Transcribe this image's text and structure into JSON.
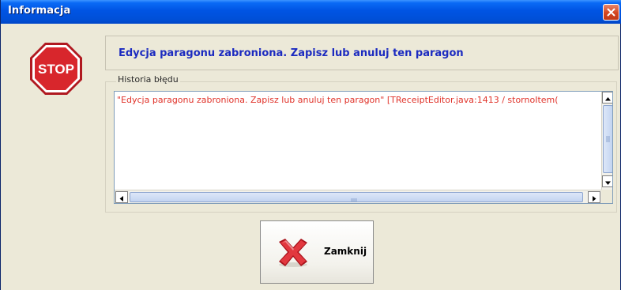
{
  "window": {
    "title": "Informacja",
    "close_icon": "close-icon"
  },
  "icon": {
    "name": "stop-sign-icon",
    "text": "STOP",
    "color": "#d8262c"
  },
  "message": {
    "text": "Edycja paragonu zabroniona. Zapisz lub anuluj ten paragon",
    "color": "#1c2bc0"
  },
  "history": {
    "legend": "Historia błędu",
    "entries": [
      "\"Edycja paragonu zabroniona. Zapisz lub anuluj ten paragon\"  [TReceiptEditor.java:1413 / stornoItem("
    ],
    "text_color": "#e0332a"
  },
  "actions": {
    "close_label": "Zamknij",
    "close_icon": "red-x-icon"
  }
}
